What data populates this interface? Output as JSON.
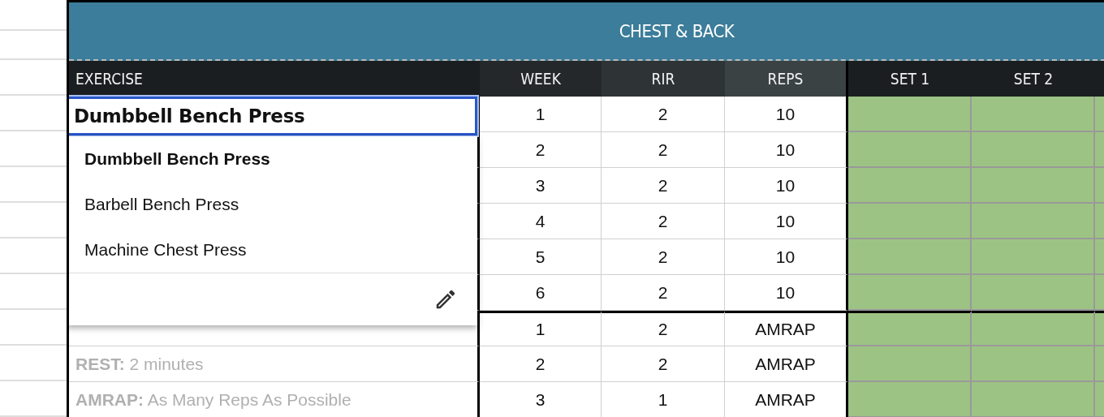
{
  "title": "CHEST & BACK",
  "columns": [
    {
      "label": "EXERCISE",
      "kind": "exercise"
    },
    {
      "label": "WEEK",
      "kind": "week"
    },
    {
      "label": "RIR",
      "kind": "rir"
    },
    {
      "label": "REPS",
      "kind": "reps"
    },
    {
      "label": "SET 1",
      "kind": "set"
    },
    {
      "label": "SET 2",
      "kind": "set"
    }
  ],
  "rows": [
    {
      "week": "1",
      "rir": "2",
      "reps": "10"
    },
    {
      "week": "2",
      "rir": "2",
      "reps": "10"
    },
    {
      "week": "3",
      "rir": "2",
      "reps": "10"
    },
    {
      "week": "4",
      "rir": "2",
      "reps": "10"
    },
    {
      "week": "5",
      "rir": "2",
      "reps": "10"
    },
    {
      "week": "6",
      "rir": "2",
      "reps": "10"
    },
    {
      "week": "1",
      "rir": "2",
      "reps": "AMRAP",
      "note": ""
    },
    {
      "week": "2",
      "rir": "2",
      "reps": "AMRAP",
      "note": "**REST:** 2 minutes"
    },
    {
      "week": "3",
      "rir": "1",
      "reps": "AMRAP",
      "note": "**AMRAP:** As Many Reps As Possible"
    }
  ],
  "editor": {
    "value": "Dumbbell Bench Press"
  },
  "suggestions": [
    {
      "label": "Dumbbell Bench Press",
      "selected": true
    },
    {
      "label": "Barbell Bench Press",
      "selected": false
    },
    {
      "label": "Machine Chest Press",
      "selected": false
    }
  ]
}
